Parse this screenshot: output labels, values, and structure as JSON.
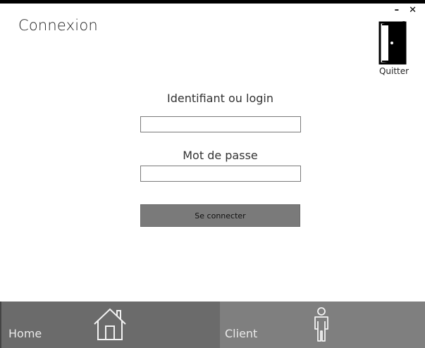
{
  "window": {
    "minimize_glyph": "–",
    "close_glyph": "✕"
  },
  "header": {
    "title": "Connexion",
    "quit_label": "Quitter",
    "quit_icon": "door-open-icon"
  },
  "form": {
    "login_label": "Identifiant ou login",
    "login_value": "",
    "password_label": "Mot de passe",
    "password_value": "",
    "submit_label": "Se connecter"
  },
  "nav": {
    "items": [
      {
        "label": "Home",
        "icon": "home-icon",
        "active": true
      },
      {
        "label": "Client",
        "icon": "person-icon",
        "active": false
      }
    ]
  },
  "colors": {
    "top_bar": "#000000",
    "button_bg": "#7a7a7a",
    "nav_home_bg": "#6b6b6b",
    "nav_client_bg": "#7f7f7f"
  }
}
